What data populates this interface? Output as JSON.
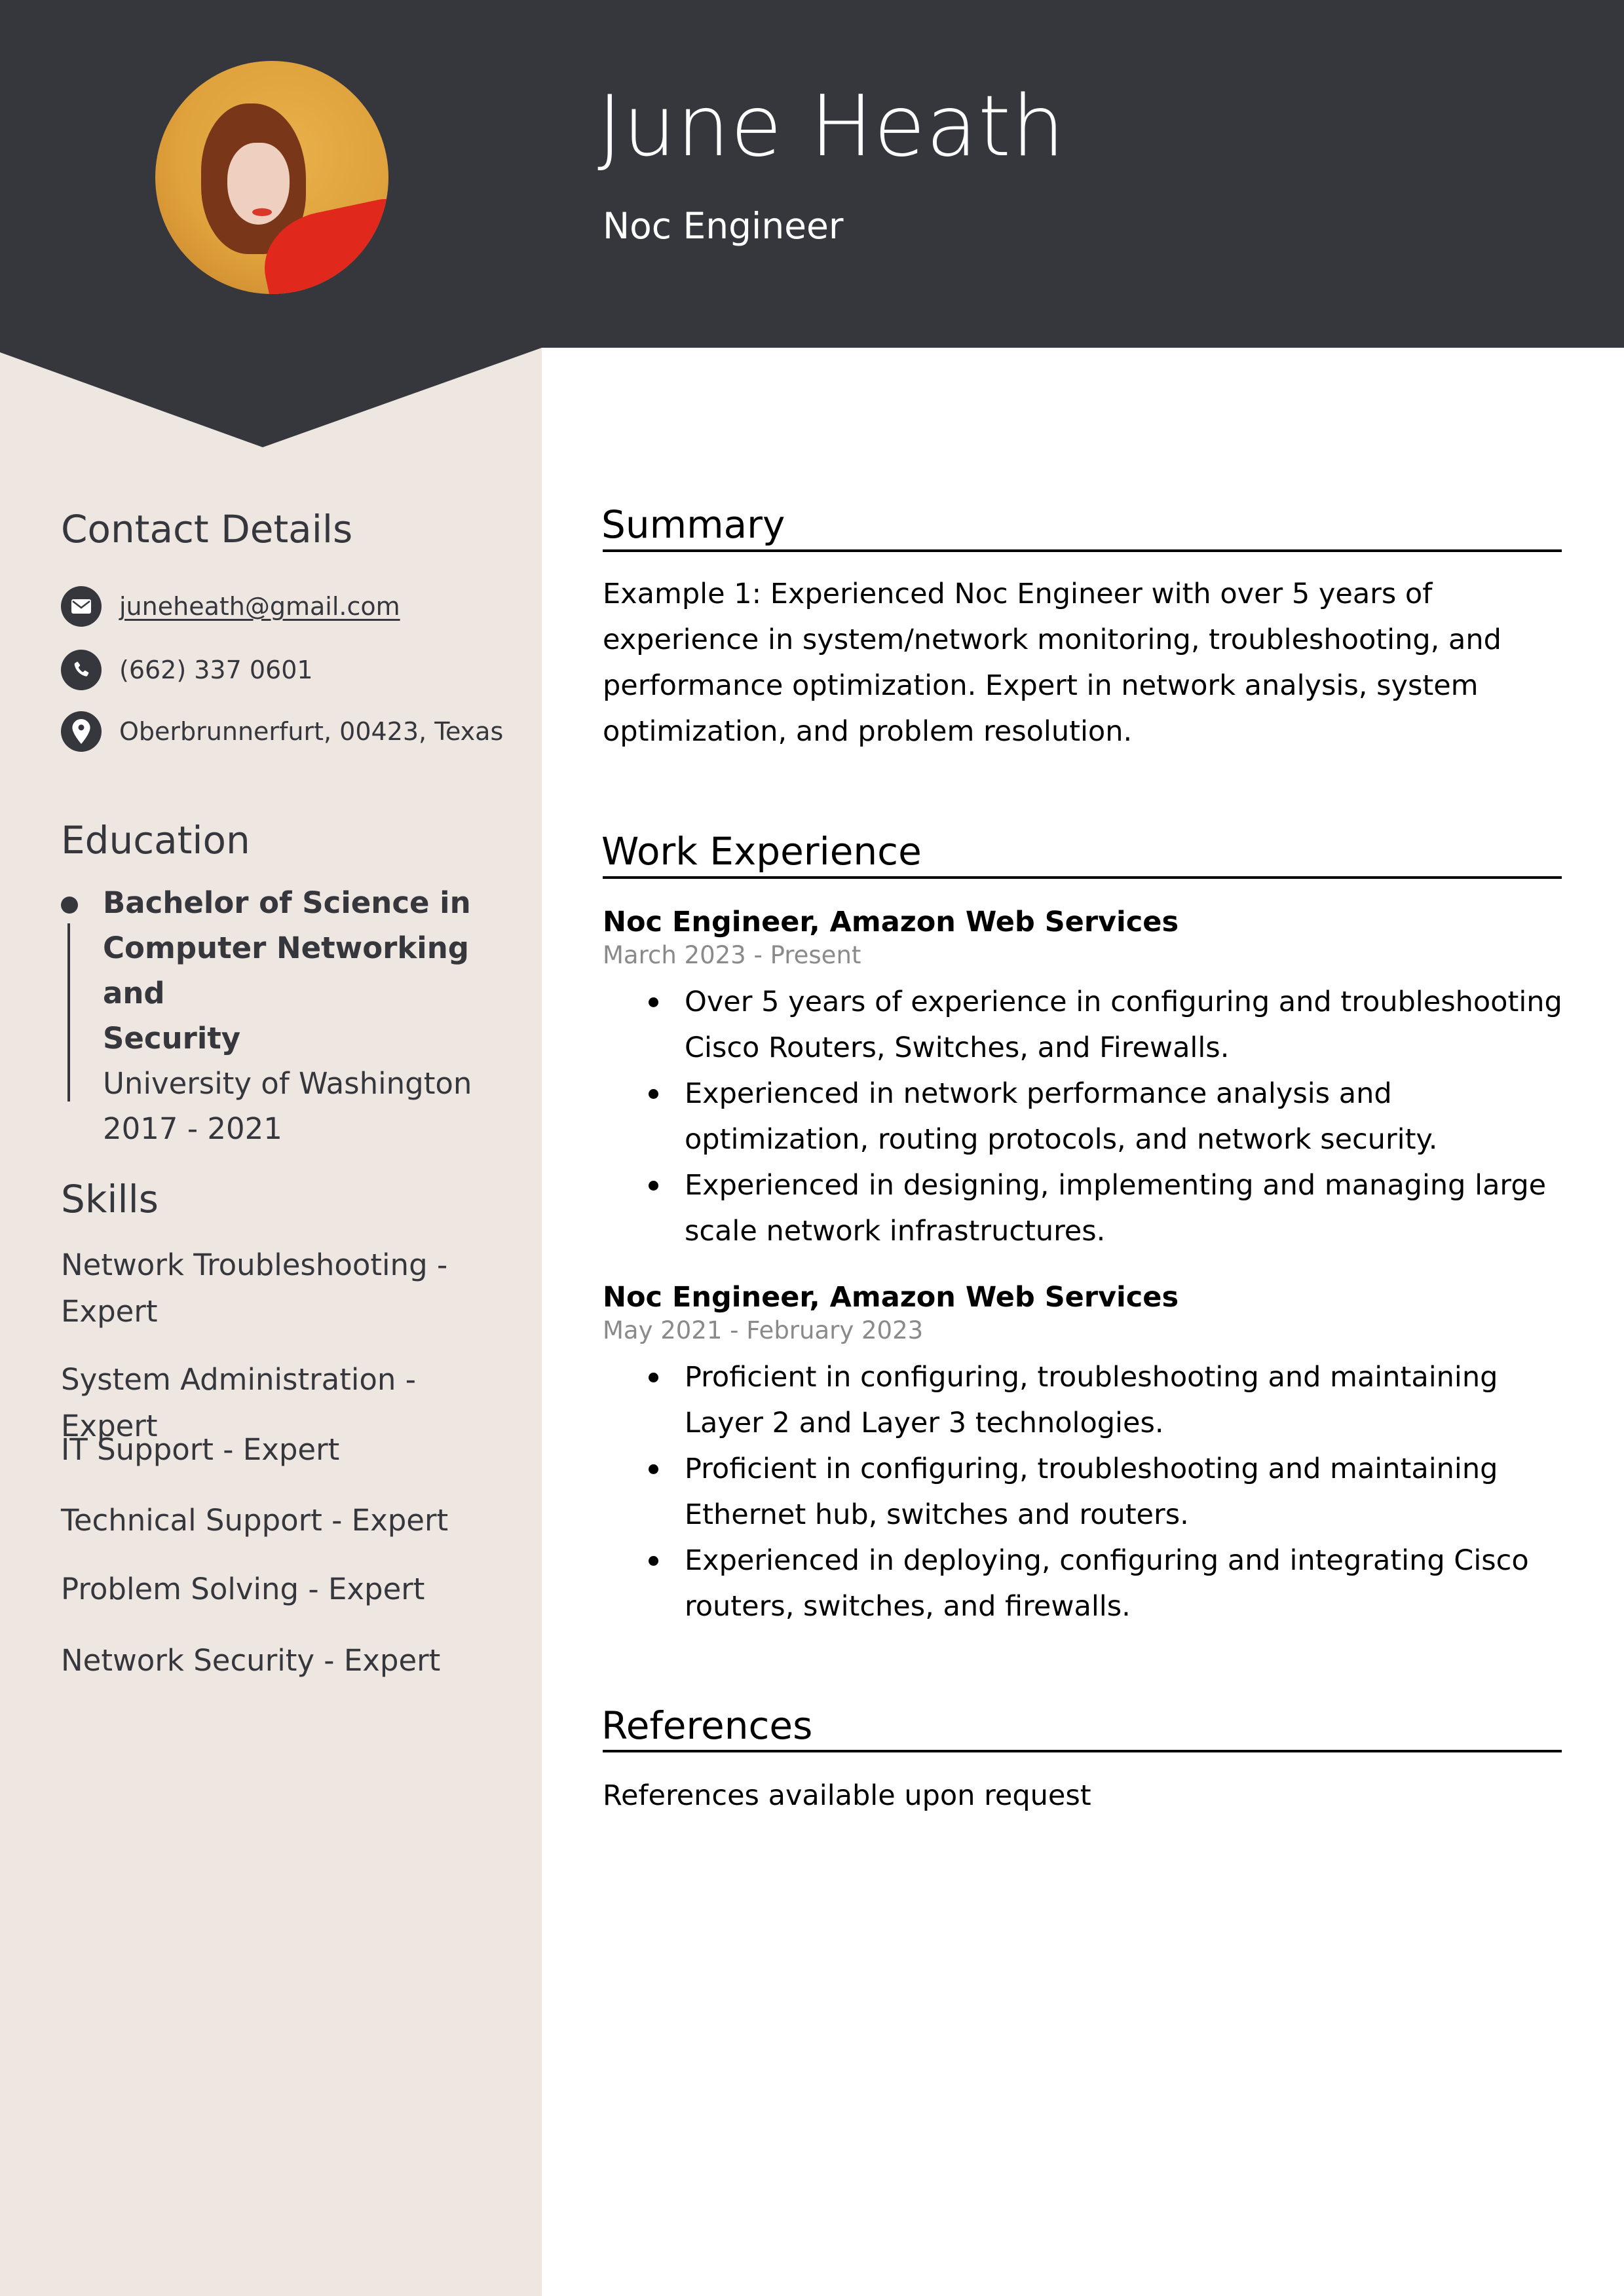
{
  "header": {
    "name": "June Heath",
    "title": "Noc Engineer",
    "photo_alt": "profile-photo"
  },
  "colors": {
    "header_bg": "#36373d",
    "sidebar_bg": "#ede6e1",
    "sidebar_text": "#36373d",
    "date_text": "#8a8a8a"
  },
  "sidebar": {
    "contact": {
      "heading": "Contact Details",
      "items": [
        {
          "icon": "envelope-icon",
          "text": "juneheath@gmail.com",
          "is_link": true
        },
        {
          "icon": "phone-icon",
          "text": "(662) 337 0601",
          "is_link": false
        },
        {
          "icon": "map-pin-icon",
          "text": "Oberbrunnerfurt, 00423, Texas",
          "is_link": false
        }
      ]
    },
    "education": {
      "heading": "Education",
      "entries": [
        {
          "degree_lines": [
            "Bachelor of Science in",
            "Computer Networking and",
            "Security"
          ],
          "degree": "Bachelor of Science in Computer Networking and Security",
          "school": "University of Washington",
          "years": "2017 - 2021"
        }
      ]
    },
    "skills": {
      "heading": "Skills",
      "items": [
        "Network Troubleshooting - Expert",
        "System Administration - Expert",
        "IT Support - Expert",
        "Technical Support - Expert",
        "Problem Solving - Expert",
        "Network Security - Expert"
      ]
    }
  },
  "main": {
    "summary": {
      "heading": "Summary",
      "text": "Example 1: Experienced Noc Engineer with over 5 years of experience in system/network monitoring, troubleshooting, and performance optimization. Expert in network analysis, system optimization, and problem resolution."
    },
    "work": {
      "heading": "Work Experience",
      "jobs": [
        {
          "role": "Noc Engineer, Amazon Web Services",
          "dates": "March 2023 - Present",
          "bullets": [
            "Over 5 years of experience in configuring and troubleshooting Cisco Routers, Switches, and Firewalls.",
            "Experienced in network performance analysis and optimization, routing protocols, and network security.",
            "Experienced in designing, implementing and managing large scale network infrastructures."
          ]
        },
        {
          "role": "Noc Engineer, Amazon Web Services",
          "dates": "May 2021 - February 2023",
          "bullets": [
            "Proficient in configuring, troubleshooting and maintaining Layer 2 and Layer 3 technologies.",
            "Proficient in configuring, troubleshooting and maintaining Ethernet hub, switches and routers.",
            "Experienced in deploying, configuring and integrating Cisco routers, switches, and firewalls."
          ]
        }
      ]
    },
    "references": {
      "heading": "References",
      "text": "References available upon request"
    }
  }
}
